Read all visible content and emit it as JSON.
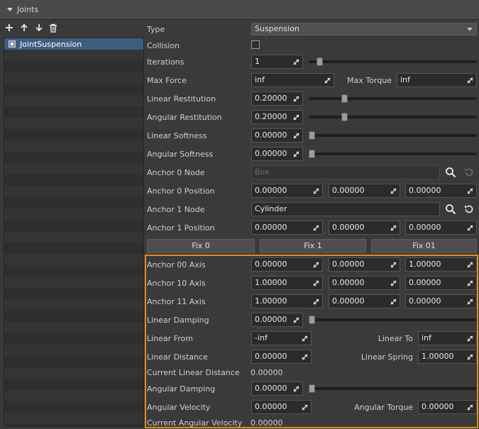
{
  "section": {
    "title": "Joints"
  },
  "list": {
    "items": [
      "JointSuspension"
    ]
  },
  "type": {
    "label": "Type",
    "value": "Suspension"
  },
  "collision": {
    "label": "Collision",
    "checked": false
  },
  "iterations": {
    "label": "Iterations",
    "value": "1",
    "slider": 0.05
  },
  "max_force": {
    "label": "Max Force",
    "value": "inf"
  },
  "max_torque": {
    "label": "Max Torque",
    "value": "inf"
  },
  "linear_restitution": {
    "label": "Linear Restitution",
    "value": "0.20000",
    "slider": 0.2
  },
  "angular_restitution": {
    "label": "Angular Restitution",
    "value": "0.20000",
    "slider": 0.2
  },
  "linear_softness": {
    "label": "Linear Softness",
    "value": "0.00000",
    "slider": 0.0
  },
  "angular_softness": {
    "label": "Angular Softness",
    "value": "0.00000",
    "slider": 0.0
  },
  "anchor0_node": {
    "label": "Anchor 0 Node",
    "value": "Box"
  },
  "anchor0_pos": {
    "label": "Anchor 0 Position",
    "x": "0.00000",
    "y": "0.00000",
    "z": "0.00000"
  },
  "anchor1_node": {
    "label": "Anchor 1 Node",
    "value": "Cylinder"
  },
  "anchor1_pos": {
    "label": "Anchor 1 Position",
    "x": "0.00000",
    "y": "0.00000",
    "z": "0.00000"
  },
  "buttons": {
    "fix0": "Fix 0",
    "fix1": "Fix 1",
    "fix01": "Fix 01"
  },
  "axis00": {
    "label": "Anchor 00 Axis",
    "x": "0.00000",
    "y": "0.00000",
    "z": "1.00000"
  },
  "axis10": {
    "label": "Anchor 10 Axis",
    "x": "1.00000",
    "y": "0.00000",
    "z": "0.00000"
  },
  "axis11": {
    "label": "Anchor 11 Axis",
    "x": "1.00000",
    "y": "0.00000",
    "z": "0.00000"
  },
  "linear_damping": {
    "label": "Linear Damping",
    "value": "0.00000",
    "slider": 0.0
  },
  "linear_from": {
    "label": "Linear From",
    "value": "-inf"
  },
  "linear_to": {
    "label": "Linear To",
    "value": "inf"
  },
  "linear_distance": {
    "label": "Linear Distance",
    "value": "0.00000"
  },
  "linear_spring": {
    "label": "Linear Spring",
    "value": "1.00000"
  },
  "current_linear_distance": {
    "label": "Current Linear Distance",
    "value": "0.00000"
  },
  "angular_damping": {
    "label": "Angular Damping",
    "value": "0.00000",
    "slider": 0.0
  },
  "angular_velocity": {
    "label": "Angular Velocity",
    "value": "0.00000"
  },
  "angular_torque": {
    "label": "Angular Torque",
    "value": "0.00000"
  },
  "current_angular_velocity": {
    "label": "Current Angular Velocity",
    "value": "0.00000"
  },
  "colors": {
    "accent": "#e08d1c",
    "selection": "#3f5d80"
  }
}
